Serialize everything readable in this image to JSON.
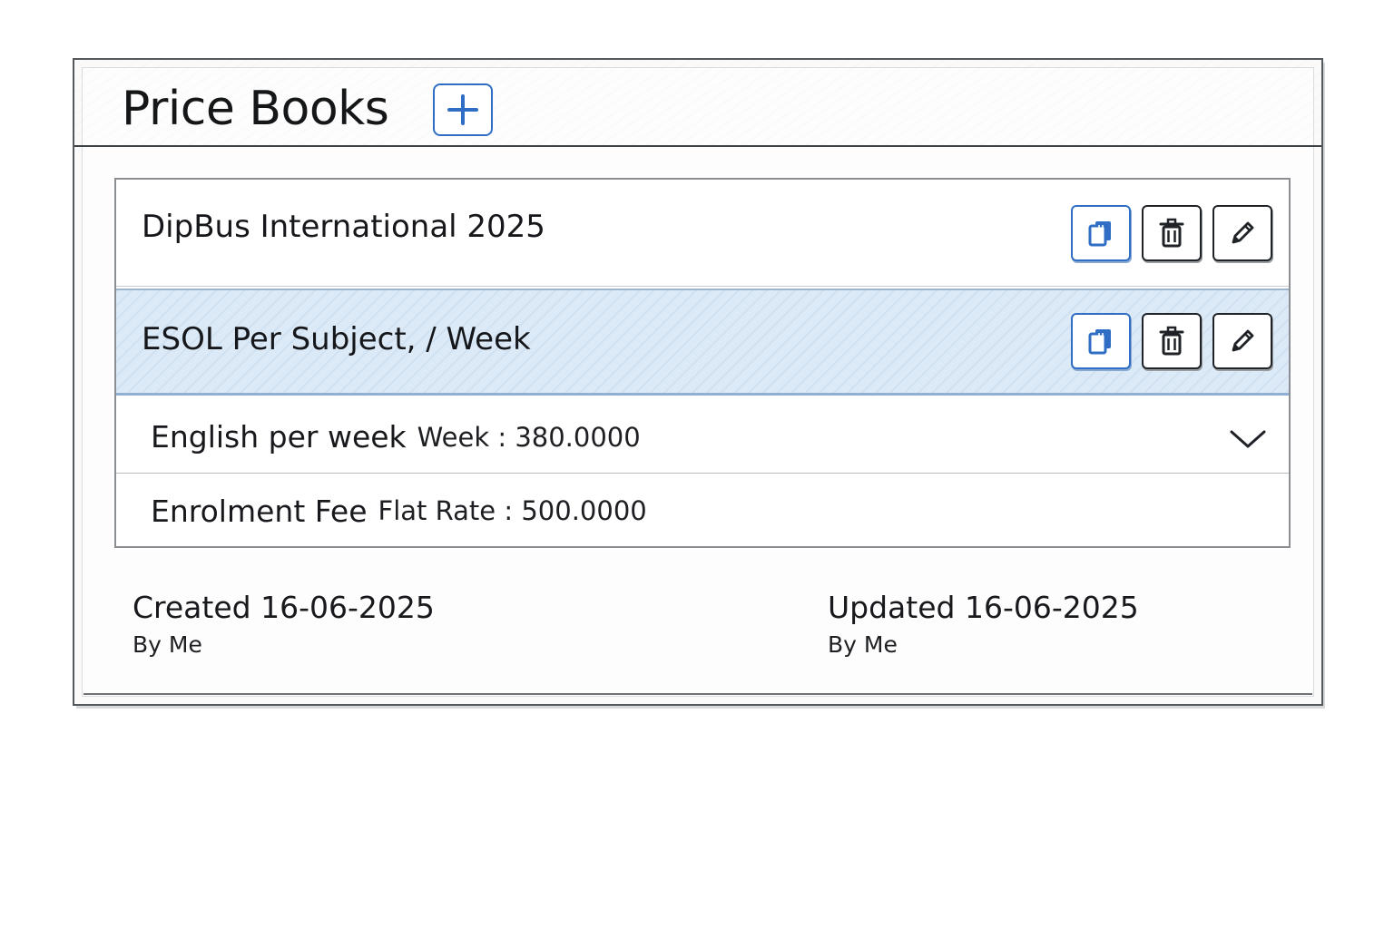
{
  "header": {
    "title": "Price Books",
    "add_icon": "plus-icon"
  },
  "price_books": [
    {
      "name": "DipBus International 2025",
      "selected": false,
      "actions": [
        "copy-icon",
        "trash-icon",
        "pencil-icon"
      ]
    },
    {
      "name": "ESOL Per Subject, / Week",
      "selected": true,
      "actions": [
        "copy-icon",
        "trash-icon",
        "pencil-icon"
      ]
    }
  ],
  "items": [
    {
      "name": "English per week",
      "rate": "Week : 380.0000",
      "expand_icon": "chevron-down-icon"
    },
    {
      "name": "Enrolment Fee",
      "rate": "Flat Rate : 500.0000"
    }
  ],
  "footer": {
    "created": {
      "label": "Created",
      "date": "16-06-2025",
      "by": "By Me"
    },
    "updated": {
      "label": "Updated",
      "date": "16-06-2025",
      "by": "By Me"
    }
  },
  "colors": {
    "accent": "#2f6ec4",
    "selected_row": "#dceaf8",
    "text": "#15171a",
    "border": "#56595c"
  }
}
